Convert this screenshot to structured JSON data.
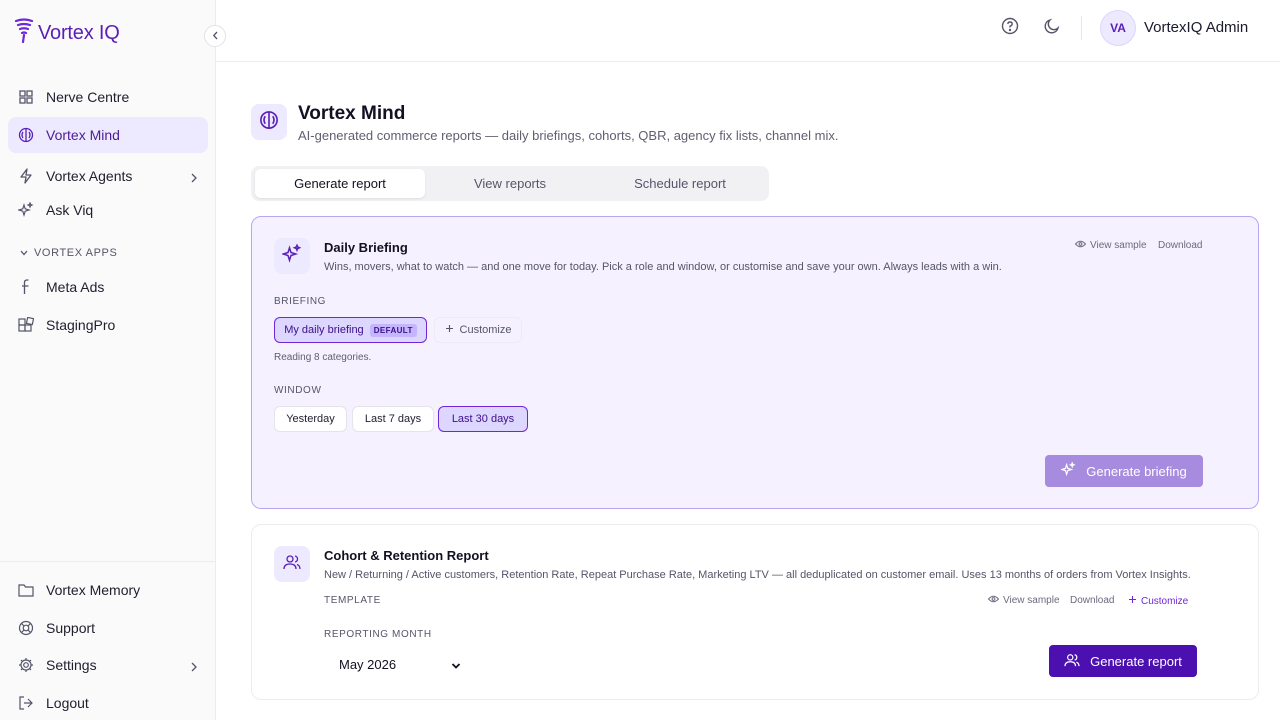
{
  "app": {
    "brand": "Vortex IQ",
    "colors": {
      "accent": "#5b21b6",
      "active_bg": "#ede9fe",
      "primary_button": "#4c0fb0"
    }
  },
  "sidebar": {
    "collapse_icon": "chevron-left-icon",
    "items": [
      {
        "label": "Nerve Centre",
        "icon": "grid-icon",
        "active": false
      },
      {
        "label": "Vortex Mind",
        "icon": "brain-icon",
        "active": true
      },
      {
        "label": "Vortex Agents",
        "icon": "bolt-icon",
        "active": false,
        "has_submenu": true
      },
      {
        "label": "Ask Viq",
        "icon": "sparkles-icon",
        "active": false
      }
    ],
    "apps_section_label": "VORTEX APPS",
    "app_items": [
      {
        "label": "Meta Ads",
        "icon": "facebook-icon"
      },
      {
        "label": "StagingPro",
        "icon": "blocks-icon"
      }
    ],
    "bottom_items": [
      {
        "label": "Vortex Memory",
        "icon": "folder-icon"
      },
      {
        "label": "Support",
        "icon": "lifebuoy-icon"
      },
      {
        "label": "Settings",
        "icon": "gear-icon",
        "has_submenu": true
      },
      {
        "label": "Logout",
        "icon": "logout-icon"
      }
    ]
  },
  "header": {
    "help_icon": "help-circle-icon",
    "theme_icon": "moon-icon",
    "user_initials": "VA",
    "user_name": "VortexIQ Admin"
  },
  "page": {
    "title": "Vortex Mind",
    "subtitle": "AI-generated commerce reports — daily briefings, cohorts, QBR, agency fix lists, channel mix.",
    "tabs": [
      {
        "label": "Generate report",
        "active": true
      },
      {
        "label": "View reports",
        "active": false
      },
      {
        "label": "Schedule report",
        "active": false
      }
    ]
  },
  "briefing_card": {
    "title": "Daily Briefing",
    "description": "Wins, movers, what to watch — and one move for today. Pick a role and window, or customise and save your own. Always leads with a win.",
    "view_sample": "View sample",
    "download": "Download",
    "briefing_label": "BRIEFING",
    "briefing_selected": "My daily briefing",
    "default_badge": "DEFAULT",
    "customize": "Customize",
    "reading_hint": "Reading 8 categories.",
    "window_label": "WINDOW",
    "window_options": [
      {
        "label": "Yesterday",
        "selected": false
      },
      {
        "label": "Last 7 days",
        "selected": false
      },
      {
        "label": "Last 30 days",
        "selected": true
      }
    ],
    "generate_button": "Generate briefing",
    "generate_enabled": false
  },
  "cohort_card": {
    "title": "Cohort & Retention Report",
    "description": "New / Returning / Active customers, Retention Rate, Repeat Purchase Rate, Marketing LTV — all deduplicated on customer email. Uses 13 months of orders from Vortex Insights.",
    "template_label": "TEMPLATE",
    "view_sample": "View sample",
    "download": "Download",
    "customize": "Customize",
    "month_label": "REPORTING MONTH",
    "month_value": "May 2026",
    "generate_button": "Generate report"
  }
}
